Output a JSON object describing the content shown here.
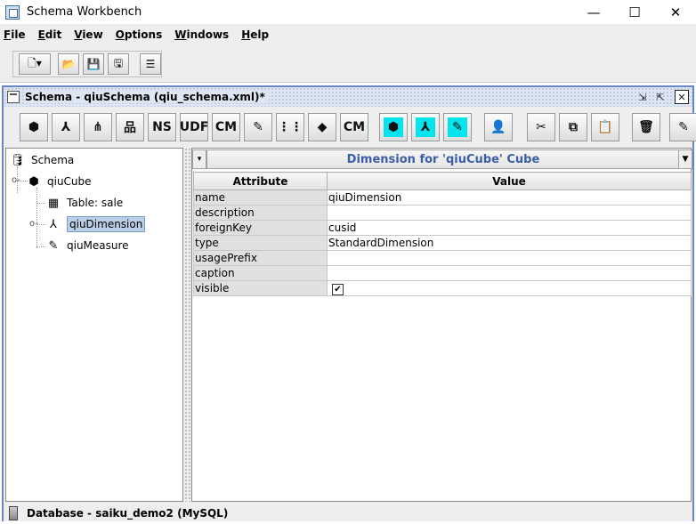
{
  "window": {
    "title": "Schema Workbench",
    "minimize": "—",
    "maximize": "☐",
    "close": "✕"
  },
  "menubar": [
    "File",
    "Edit",
    "View",
    "Options",
    "Windows",
    "Help"
  ],
  "main_toolbar": {
    "icons": [
      "new-icon",
      "open-icon",
      "save-icon",
      "save-as-icon",
      "preferences-icon"
    ]
  },
  "schema_frame": {
    "title": "Schema - qiuSchema (qiu_schema.xml)*",
    "controls": [
      "restore-icon",
      "maximize-icon",
      "close-icon"
    ]
  },
  "schema_toolbar": {
    "buttons": [
      {
        "icon": "add-cube-icon",
        "label": "⬢"
      },
      {
        "icon": "add-dimension-icon",
        "label": "⅄"
      },
      {
        "icon": "add-dimension-usage-icon",
        "label": "⋔"
      },
      {
        "icon": "add-hierarchy-icon",
        "label": "品"
      },
      {
        "icon": "add-named-set-icon",
        "label": "NS"
      },
      {
        "icon": "add-udf-icon",
        "label": "UDF"
      },
      {
        "icon": "add-calculated-member-icon",
        "label": "CM"
      },
      {
        "icon": "add-measure-icon",
        "label": "✎"
      },
      {
        "icon": "add-level-icon",
        "label": "⋮⋮"
      },
      {
        "icon": "add-property-icon",
        "label": "◆"
      },
      {
        "icon": "add-calculated-member-property-icon",
        "label": "CM"
      },
      {
        "icon": "add-virtual-cube-icon",
        "label": "⬢"
      },
      {
        "icon": "add-virtual-dimension-icon",
        "label": "⅄"
      },
      {
        "icon": "add-virtual-measure-icon",
        "label": "✎"
      },
      {
        "icon": "add-role-icon",
        "label": "👤"
      },
      {
        "icon": "cut-icon",
        "label": "✂"
      },
      {
        "icon": "copy-icon",
        "label": "⧉"
      },
      {
        "icon": "paste-icon",
        "label": "📋"
      },
      {
        "icon": "delete-icon",
        "label": "🗑"
      },
      {
        "icon": "edit-mode-icon",
        "label": "✎"
      }
    ]
  },
  "tree": {
    "root": "Schema",
    "nodes": [
      {
        "label": "qiuCube",
        "icon": "cube-icon"
      },
      {
        "label": "Table: sale",
        "icon": "table-icon"
      },
      {
        "label": "qiuDimension",
        "icon": "dimension-icon"
      },
      {
        "label": "qiuMeasure",
        "icon": "measure-icon"
      }
    ]
  },
  "properties": {
    "header": "Dimension for 'qiuCube' Cube",
    "columns": [
      "Attribute",
      "Value"
    ],
    "rows": [
      {
        "attr": "name",
        "value": "qiuDimension"
      },
      {
        "attr": "description",
        "value": ""
      },
      {
        "attr": "foreignKey",
        "value": "cusid"
      },
      {
        "attr": "type",
        "value": "StandardDimension"
      },
      {
        "attr": "usagePrefix",
        "value": ""
      },
      {
        "attr": "caption",
        "value": ""
      },
      {
        "attr": "visible",
        "value": "✔"
      }
    ]
  },
  "status": {
    "text": "Database - saiku_demo2 (MySQL)"
  },
  "colors": {
    "frame_border": "#6b86c4",
    "header_text": "#3c5ea8",
    "cyan_button": "#00e5ee",
    "selection": "#b8cfe5"
  }
}
